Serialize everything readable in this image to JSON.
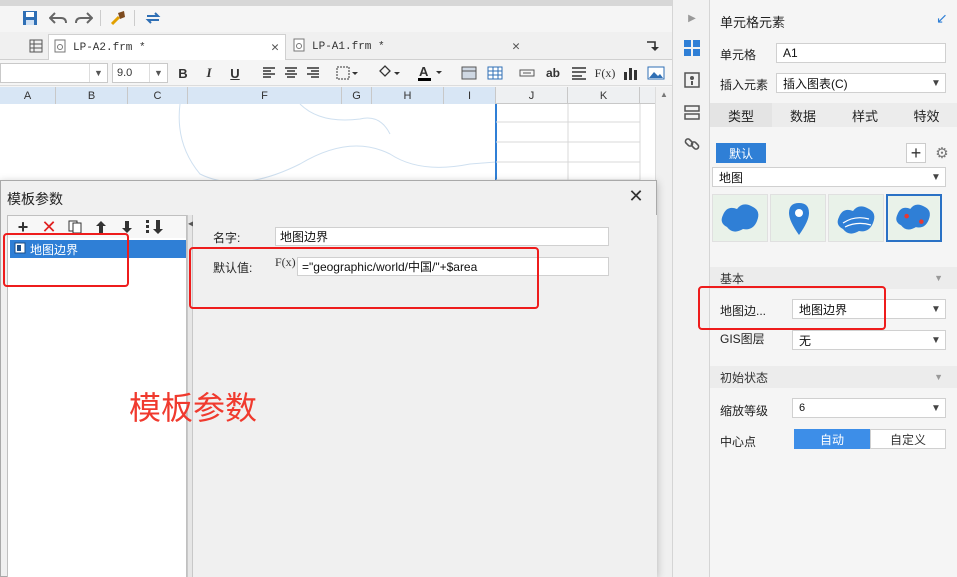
{
  "tabs": [
    {
      "label": "LP-A2.frm *",
      "active": true
    },
    {
      "label": "LP-A1.frm *",
      "active": false
    }
  ],
  "format_toolbar": {
    "font_size": "9.0",
    "bold": "B",
    "italic": "I",
    "underline": "U",
    "ab_label": "ab",
    "formula_label": "F(x)"
  },
  "grid": {
    "columns": [
      "A",
      "B",
      "C",
      "F",
      "G",
      "H",
      "I",
      "J",
      "K"
    ]
  },
  "dialog": {
    "title": "模板参数",
    "tree_items": [
      "地图边界"
    ],
    "name_label": "名字:",
    "name_value": "地图边界",
    "default_label": "默认值:",
    "default_formula_icon": "F(x)",
    "default_value": "=\"geographic/world/中国/\"+$area",
    "annotation": "模板参数"
  },
  "right_panel": {
    "header": "单元格元素",
    "cell_label": "单元格",
    "cell_value": "A1",
    "insert_label": "插入元素",
    "insert_value": "插入图表(C)",
    "tabs": [
      "类型",
      "数据",
      "样式",
      "特效"
    ],
    "active_tab": "类型",
    "default_button": "默认",
    "chart_type": "地图",
    "basic_section": "基本",
    "map_boundary_label": "地图边...",
    "map_boundary_value": "地图边界",
    "gis_label": "GIS图层",
    "gis_value": "无",
    "initial_section": "初始状态",
    "zoom_label": "缩放等级",
    "zoom_value": "6",
    "center_label": "中心点",
    "center_auto": "自动",
    "center_custom": "自定义"
  },
  "colors": {
    "accent": "#2f7fd6",
    "annotation_red": "#ee1c1c",
    "toggle_active": "#3d8ee8"
  }
}
